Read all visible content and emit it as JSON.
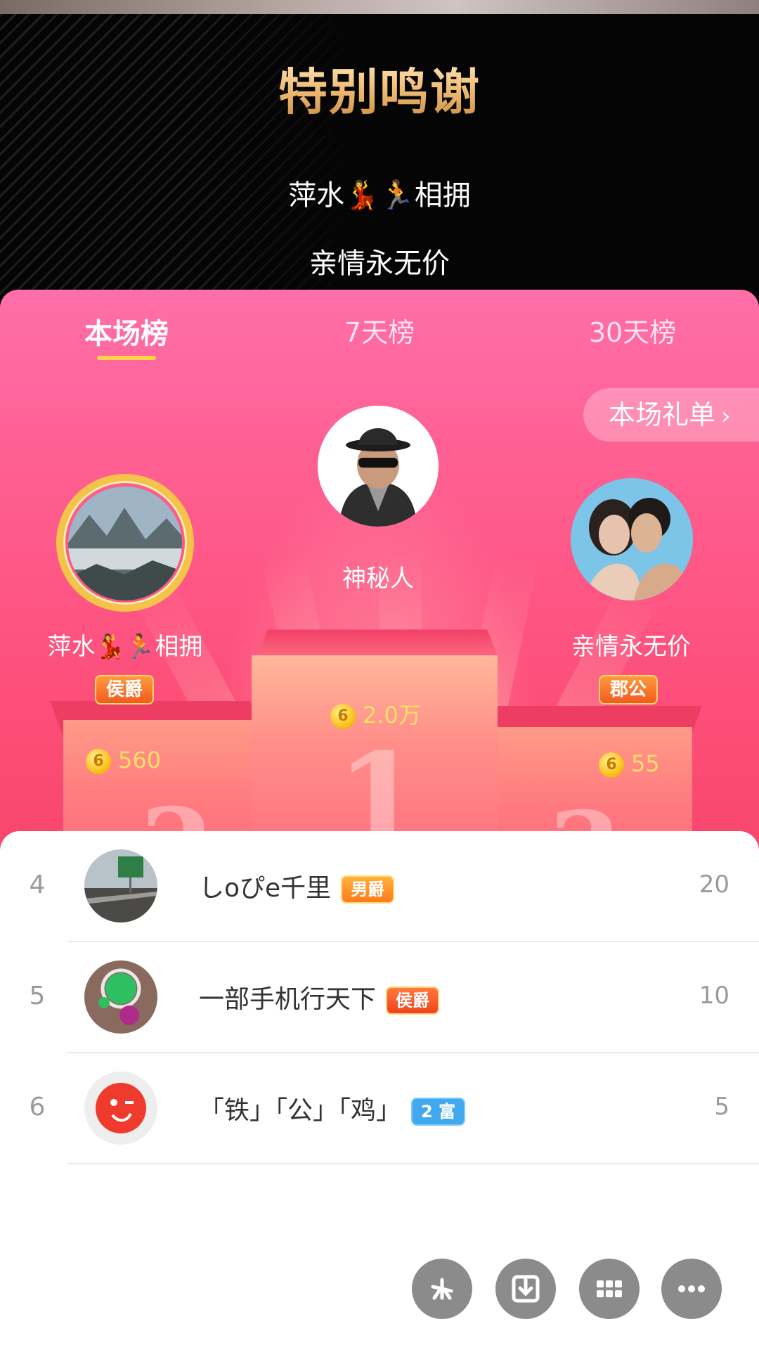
{
  "header": {
    "title": "特别鸣谢",
    "thanks": [
      "萍水💃🏃相拥",
      "亲情永无价"
    ]
  },
  "tabs": [
    {
      "label": "本场榜",
      "active": true
    },
    {
      "label": "7天榜",
      "active": false
    },
    {
      "label": "30天榜",
      "active": false
    }
  ],
  "gift_list_button": "本场礼单",
  "podium": {
    "first": {
      "rank": "1",
      "name": "神秘人",
      "score": "2.0万",
      "avatar_icon": "mystery-person-icon"
    },
    "second": {
      "rank": "2",
      "name": "萍水💃🏃相拥",
      "title_badge": "侯爵",
      "score": "560"
    },
    "third": {
      "rank": "3",
      "name": "亲情永无价",
      "title_badge": "郡公",
      "score": "55"
    }
  },
  "list": [
    {
      "rank": "4",
      "name": "しoぴe千里",
      "badge": "男爵",
      "score": "20"
    },
    {
      "rank": "5",
      "name": "一部手机行天下",
      "badge": "侯爵",
      "score": "10"
    },
    {
      "rank": "6",
      "name": "「铁」「公」「鸡」",
      "badge": "2 富",
      "score": "5"
    }
  ],
  "actions": [
    "share-icon",
    "download-icon",
    "grid-icon",
    "more-icon"
  ],
  "colors": {
    "header_bg": "#050505",
    "card_pink": "#ff5f92",
    "tab_underline": "#ffd24a",
    "coin_text": "#ffe066",
    "badge_blue": "#43a9ee"
  }
}
